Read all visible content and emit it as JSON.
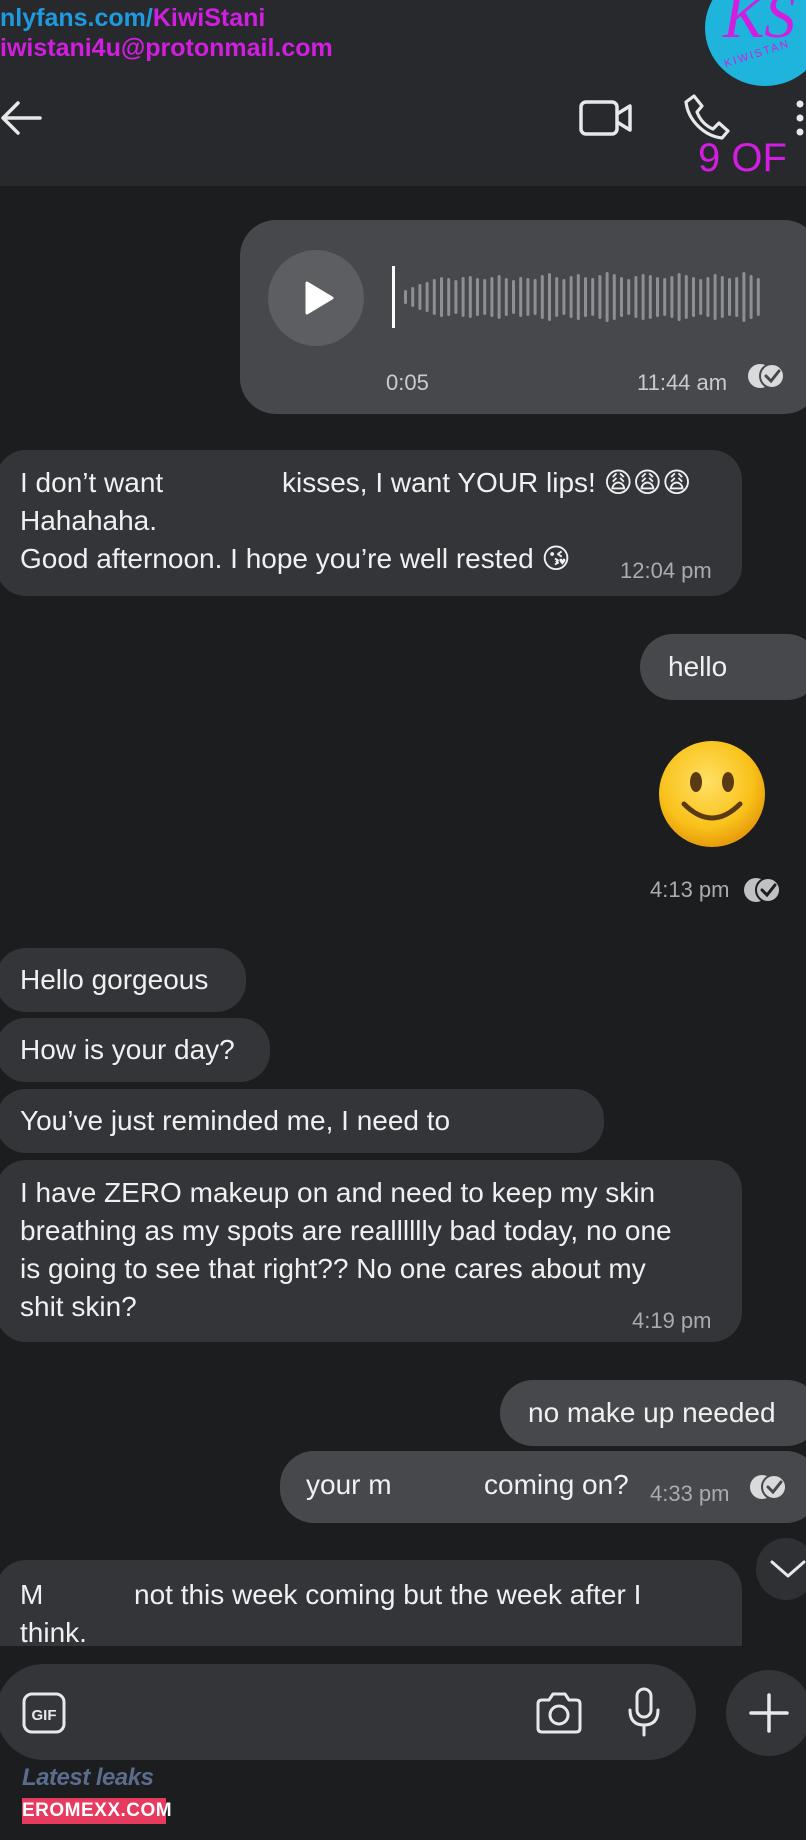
{
  "watermark": {
    "line1_prefix": "nlyfans.com/",
    "line1_name": "KiwiStani",
    "line2": "iwistani4u@protonmail.com",
    "logo_mono": "KS",
    "logo_ring": "KIWISTAN",
    "of_count": "9 OF",
    "bottom_line1": "Latest leaks",
    "bottom_line2": "EROMEXX.COM"
  },
  "header": {
    "icons": [
      "back-arrow-icon",
      "video-call-icon",
      "phone-icon",
      "more-vert-icon"
    ]
  },
  "voice_message": {
    "duration": "0:05",
    "time": "11:44 am"
  },
  "messages": {
    "m1": {
      "line1a": "I don’t want",
      "line1b": "kisses, I want YOUR lips! 😩😩😩",
      "line2": "Hahahaha.",
      "line3": "Good afternoon. I hope you’re well rested 😘",
      "time": "12:04 pm"
    },
    "m2": {
      "text": "hello"
    },
    "m3": {
      "emoji": "smiling-face-emoji",
      "time": "4:13 pm"
    },
    "m4": {
      "text": "Hello gorgeous"
    },
    "m5": {
      "text": "How is your day?"
    },
    "m6": {
      "text": "You’ve just reminded me, I need to"
    },
    "m7": {
      "line1": "I have ZERO makeup on and need to keep my skin",
      "line2": "breathing as my spots are realllllly bad today, no one",
      "line3": "is going to see that right?? No one cares about my",
      "line4": "shit skin?",
      "time": "4:19 pm"
    },
    "m8": {
      "text": "no make up needed"
    },
    "m9": {
      "text_a": "your m",
      "text_b": "coming on?",
      "time": "4:33 pm"
    },
    "m10": {
      "line1a": "M",
      "line1b": "not this week coming but the week after I",
      "line2": "think."
    }
  },
  "composer": {
    "gif_label": "GIF",
    "icons": [
      "gif-icon",
      "camera-icon",
      "mic-icon",
      "plus-icon"
    ]
  },
  "colors": {
    "background": "#1c1d1f",
    "header": "#27292c",
    "incoming_bubble": "#333538",
    "outgoing_bubble": "#46484b",
    "watermark_magenta": "#d21ee0",
    "watermark_blue": "#1e9be0"
  }
}
